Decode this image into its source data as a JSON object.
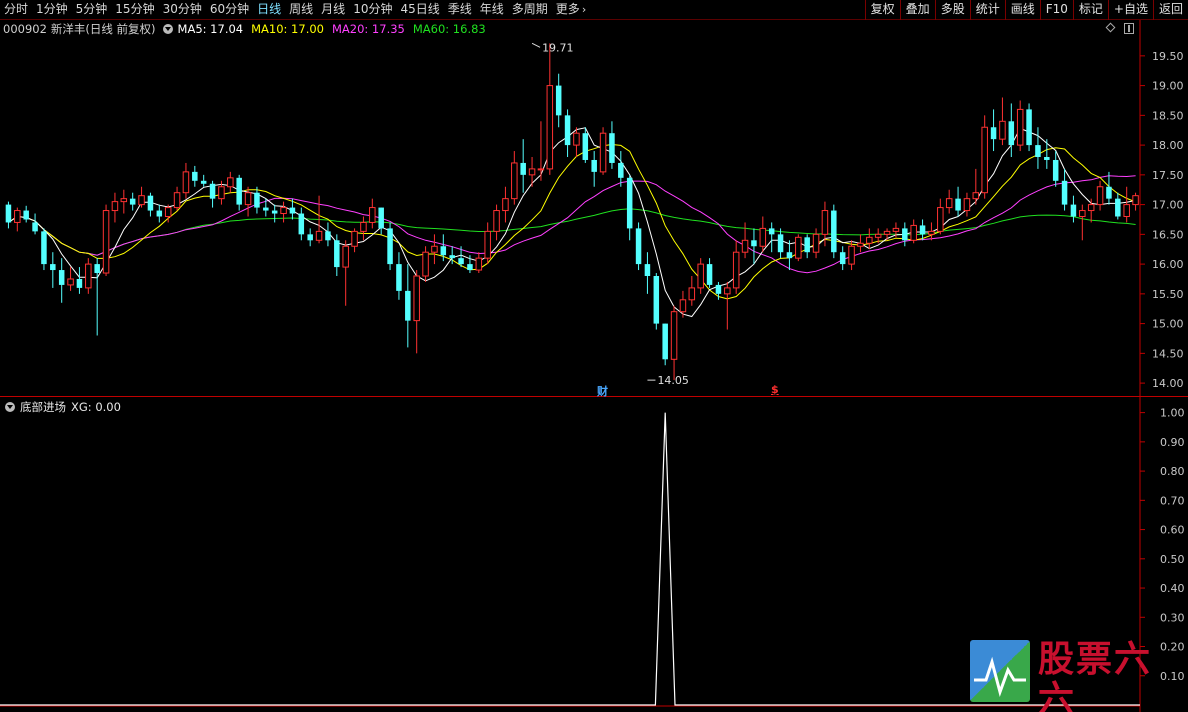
{
  "toolbar": {
    "tabs": [
      {
        "label": "分时"
      },
      {
        "label": "1分钟"
      },
      {
        "label": "5分钟"
      },
      {
        "label": "15分钟"
      },
      {
        "label": "30分钟"
      },
      {
        "label": "60分钟"
      },
      {
        "label": "日线"
      },
      {
        "label": "周线"
      },
      {
        "label": "月线"
      },
      {
        "label": "10分钟"
      },
      {
        "label": "45日线"
      },
      {
        "label": "季线"
      },
      {
        "label": "年线"
      },
      {
        "label": "多周期"
      }
    ],
    "active_tab": "日线",
    "more_label": "更多",
    "right_buttons": [
      {
        "label": "复权"
      },
      {
        "label": "叠加"
      },
      {
        "label": "多股"
      },
      {
        "label": "统计"
      },
      {
        "label": "画线"
      },
      {
        "label": "F10"
      },
      {
        "label": "标记"
      },
      {
        "label": "+自选"
      },
      {
        "label": "返回"
      }
    ]
  },
  "stock": {
    "code": "000902",
    "name": "新洋丰(日线 前复权)",
    "ma5": "MA5: 17.04",
    "ma10": "MA10: 17.00",
    "ma20": "MA20: 17.35",
    "ma60": "MA60: 16.83"
  },
  "indicator": {
    "name": "底部进场",
    "value": "XG: 0.00"
  },
  "markers": {
    "cai": "财",
    "s": "$"
  },
  "colors": {
    "up": "#ff3232",
    "down": "#54ffff",
    "ma5": "#ffffff",
    "ma10": "#ffff00",
    "ma20": "#ff40ff",
    "ma60": "#20e020",
    "axis": "#c00000",
    "axis_text": "#c8c8c8"
  },
  "chart_data": [
    {
      "type": "candlestick",
      "ylim": [
        13.8,
        19.8
      ],
      "yticks": [
        "19.50",
        "19.00",
        "18.50",
        "18.00",
        "17.50",
        "17.00",
        "16.50",
        "16.00",
        "15.50",
        "15.00",
        "14.50",
        "14.00"
      ],
      "annotations": [
        {
          "text": "19.71",
          "bar_index": 59,
          "value": 19.71
        },
        {
          "text": "14.05",
          "bar_index": 72,
          "value": 14.05
        }
      ],
      "ohlc": [
        [
          17.0,
          17.05,
          16.6,
          16.7
        ],
        [
          16.7,
          16.95,
          16.55,
          16.9
        ],
        [
          16.9,
          16.98,
          16.7,
          16.75
        ],
        [
          16.7,
          16.85,
          16.5,
          16.55
        ],
        [
          16.55,
          16.6,
          15.9,
          16.0
        ],
        [
          16.0,
          16.2,
          15.6,
          15.9
        ],
        [
          15.9,
          16.1,
          15.35,
          15.65
        ],
        [
          15.65,
          15.95,
          15.55,
          15.75
        ],
        [
          15.75,
          15.95,
          15.5,
          15.6
        ],
        [
          15.6,
          16.1,
          15.5,
          16.0
        ],
        [
          16.0,
          16.1,
          14.8,
          15.85
        ],
        [
          15.85,
          17.0,
          15.8,
          16.9
        ],
        [
          16.9,
          17.2,
          16.7,
          17.05
        ],
        [
          17.05,
          17.25,
          16.85,
          17.1
        ],
        [
          17.1,
          17.2,
          16.9,
          17.0
        ],
        [
          17.0,
          17.3,
          16.95,
          17.15
        ],
        [
          17.15,
          17.2,
          16.8,
          16.9
        ],
        [
          16.9,
          17.0,
          16.7,
          16.8
        ],
        [
          16.8,
          17.0,
          16.7,
          16.95
        ],
        [
          16.95,
          17.3,
          16.9,
          17.2
        ],
        [
          17.2,
          17.7,
          17.1,
          17.55
        ],
        [
          17.55,
          17.65,
          17.3,
          17.4
        ],
        [
          17.4,
          17.5,
          17.3,
          17.35
        ],
        [
          17.35,
          17.4,
          16.95,
          17.1
        ],
        [
          17.1,
          17.4,
          17.0,
          17.3
        ],
        [
          17.3,
          17.55,
          17.2,
          17.45
        ],
        [
          17.45,
          17.5,
          16.9,
          17.0
        ],
        [
          17.0,
          17.3,
          16.8,
          17.2
        ],
        [
          17.2,
          17.3,
          16.85,
          16.95
        ],
        [
          16.95,
          17.1,
          16.8,
          16.9
        ],
        [
          16.9,
          17.0,
          16.7,
          16.85
        ],
        [
          16.85,
          17.05,
          16.7,
          16.95
        ],
        [
          16.95,
          17.1,
          16.75,
          16.85
        ],
        [
          16.85,
          16.95,
          16.4,
          16.5
        ],
        [
          16.5,
          16.6,
          16.3,
          16.4
        ],
        [
          16.4,
          17.15,
          16.35,
          16.55
        ],
        [
          16.55,
          16.7,
          16.3,
          16.4
        ],
        [
          16.4,
          16.5,
          15.8,
          15.95
        ],
        [
          15.95,
          16.4,
          15.3,
          16.3
        ],
        [
          16.3,
          16.6,
          16.2,
          16.55
        ],
        [
          16.55,
          16.8,
          16.4,
          16.7
        ],
        [
          16.7,
          17.1,
          16.6,
          16.95
        ],
        [
          16.95,
          16.95,
          16.5,
          16.6
        ],
        [
          16.6,
          16.7,
          15.9,
          16.0
        ],
        [
          16.0,
          16.2,
          15.4,
          15.55
        ],
        [
          15.55,
          16.0,
          14.6,
          15.05
        ],
        [
          15.05,
          15.9,
          14.5,
          15.8
        ],
        [
          15.8,
          16.3,
          15.7,
          16.2
        ],
        [
          16.2,
          16.5,
          16.0,
          16.3
        ],
        [
          16.3,
          16.5,
          16.05,
          16.15
        ],
        [
          16.15,
          16.3,
          16.0,
          16.1
        ],
        [
          16.1,
          16.3,
          15.95,
          16.0
        ],
        [
          16.0,
          16.15,
          15.85,
          15.9
        ],
        [
          15.9,
          16.2,
          15.85,
          16.1
        ],
        [
          16.1,
          16.7,
          16.0,
          16.55
        ],
        [
          16.55,
          17.0,
          16.4,
          16.9
        ],
        [
          16.9,
          17.3,
          16.7,
          17.1
        ],
        [
          17.1,
          17.9,
          17.0,
          17.7
        ],
        [
          17.7,
          18.1,
          17.2,
          17.5
        ],
        [
          17.5,
          17.8,
          17.3,
          17.6
        ],
        [
          17.6,
          18.4,
          17.4,
          17.6
        ],
        [
          17.6,
          19.71,
          17.5,
          19.0
        ],
        [
          19.0,
          19.2,
          18.3,
          18.5
        ],
        [
          18.5,
          18.6,
          17.8,
          18.0
        ],
        [
          18.0,
          18.3,
          17.8,
          18.2
        ],
        [
          18.2,
          18.3,
          17.7,
          17.75
        ],
        [
          17.75,
          17.9,
          17.3,
          17.55
        ],
        [
          17.55,
          18.3,
          17.5,
          18.2
        ],
        [
          18.2,
          18.4,
          17.6,
          17.7
        ],
        [
          17.7,
          17.9,
          17.3,
          17.45
        ],
        [
          17.45,
          17.5,
          16.4,
          16.6
        ],
        [
          16.6,
          16.7,
          15.9,
          16.0
        ],
        [
          16.0,
          16.2,
          15.5,
          15.8
        ],
        [
          15.8,
          15.85,
          14.9,
          15.0
        ],
        [
          15.0,
          15.0,
          14.3,
          14.4
        ],
        [
          14.4,
          15.3,
          14.05,
          15.2
        ],
        [
          15.2,
          15.55,
          15.1,
          15.4
        ],
        [
          15.4,
          15.8,
          15.3,
          15.6
        ],
        [
          15.6,
          16.1,
          15.5,
          16.0
        ],
        [
          16.0,
          16.1,
          15.6,
          15.65
        ],
        [
          15.65,
          15.7,
          15.4,
          15.5
        ],
        [
          15.5,
          15.7,
          14.9,
          15.6
        ],
        [
          15.6,
          16.4,
          15.5,
          16.2
        ],
        [
          16.2,
          16.7,
          16.1,
          16.4
        ],
        [
          16.4,
          16.6,
          16.0,
          16.3
        ],
        [
          16.3,
          16.8,
          16.2,
          16.6
        ],
        [
          16.6,
          16.7,
          16.2,
          16.5
        ],
        [
          16.5,
          16.6,
          16.1,
          16.2
        ],
        [
          16.2,
          16.4,
          15.9,
          16.1
        ],
        [
          16.1,
          16.5,
          16.05,
          16.45
        ],
        [
          16.45,
          16.5,
          16.1,
          16.2
        ],
        [
          16.2,
          16.6,
          16.1,
          16.5
        ],
        [
          16.5,
          17.05,
          16.3,
          16.9
        ],
        [
          16.9,
          17.0,
          16.1,
          16.2
        ],
        [
          16.2,
          16.3,
          15.9,
          16.0
        ],
        [
          16.0,
          16.4,
          15.9,
          16.3
        ],
        [
          16.3,
          16.5,
          16.2,
          16.35
        ],
        [
          16.35,
          16.6,
          16.25,
          16.45
        ],
        [
          16.45,
          16.6,
          16.35,
          16.5
        ],
        [
          16.5,
          16.6,
          16.4,
          16.55
        ],
        [
          16.55,
          16.7,
          16.45,
          16.6
        ],
        [
          16.6,
          16.7,
          16.3,
          16.4
        ],
        [
          16.4,
          16.75,
          16.35,
          16.65
        ],
        [
          16.65,
          16.75,
          16.4,
          16.5
        ],
        [
          16.5,
          16.7,
          16.4,
          16.55
        ],
        [
          16.55,
          17.1,
          16.5,
          16.95
        ],
        [
          16.95,
          17.25,
          16.85,
          17.1
        ],
        [
          17.1,
          17.3,
          16.8,
          16.9
        ],
        [
          16.9,
          17.2,
          16.8,
          17.1
        ],
        [
          17.1,
          17.6,
          17.0,
          17.2
        ],
        [
          17.2,
          18.5,
          17.1,
          18.3
        ],
        [
          18.3,
          18.6,
          17.9,
          18.1
        ],
        [
          18.1,
          18.8,
          18.0,
          18.4
        ],
        [
          18.4,
          18.7,
          17.8,
          18.0
        ],
        [
          18.0,
          18.75,
          17.9,
          18.6
        ],
        [
          18.6,
          18.7,
          17.9,
          18.0
        ],
        [
          18.0,
          18.3,
          17.6,
          17.8
        ],
        [
          17.8,
          18.1,
          17.6,
          17.75
        ],
        [
          17.75,
          17.9,
          17.3,
          17.4
        ],
        [
          17.4,
          17.6,
          16.9,
          17.0
        ],
        [
          17.0,
          17.15,
          16.7,
          16.8
        ],
        [
          16.8,
          17.0,
          16.4,
          16.9
        ],
        [
          16.9,
          17.1,
          16.7,
          17.0
        ],
        [
          17.0,
          17.4,
          16.9,
          17.3
        ],
        [
          17.3,
          17.55,
          17.0,
          17.1
        ],
        [
          17.1,
          17.2,
          16.75,
          16.8
        ],
        [
          16.8,
          17.3,
          16.7,
          17.0
        ],
        [
          17.0,
          17.2,
          16.9,
          17.15
        ]
      ]
    },
    {
      "type": "line",
      "name": "底部进场",
      "ylim": [
        0,
        1.05
      ],
      "yticks": [
        "1.00",
        "0.90",
        "0.80",
        "0.70",
        "0.60",
        "0.50",
        "0.40",
        "0.30",
        "0.20",
        "0.10"
      ],
      "signal_bar_index": 74,
      "values_note": "XG = 1 at signal bar, 0 elsewhere"
    }
  ]
}
